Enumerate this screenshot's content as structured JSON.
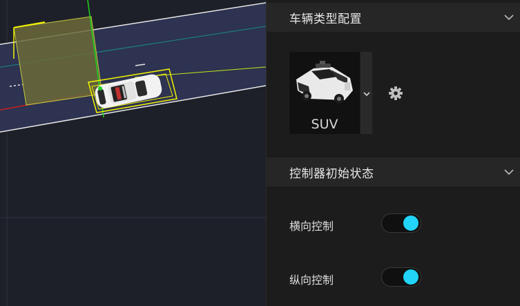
{
  "vehicle_section": {
    "title": "车辆类型配置",
    "vehicle_name": "SUV",
    "chevron_icon": "chevron-down-icon"
  },
  "controller_section": {
    "title": "控制器初始状态",
    "lateral_label": "横向控制",
    "lateral_on": true,
    "longitudinal_label": "纵向控制",
    "longitudinal_on": true
  },
  "colors": {
    "toggle_on": "#21d4f8",
    "road": "#2d3350",
    "trigger_area": "#6b6a38",
    "bbox": "#f4f400"
  }
}
